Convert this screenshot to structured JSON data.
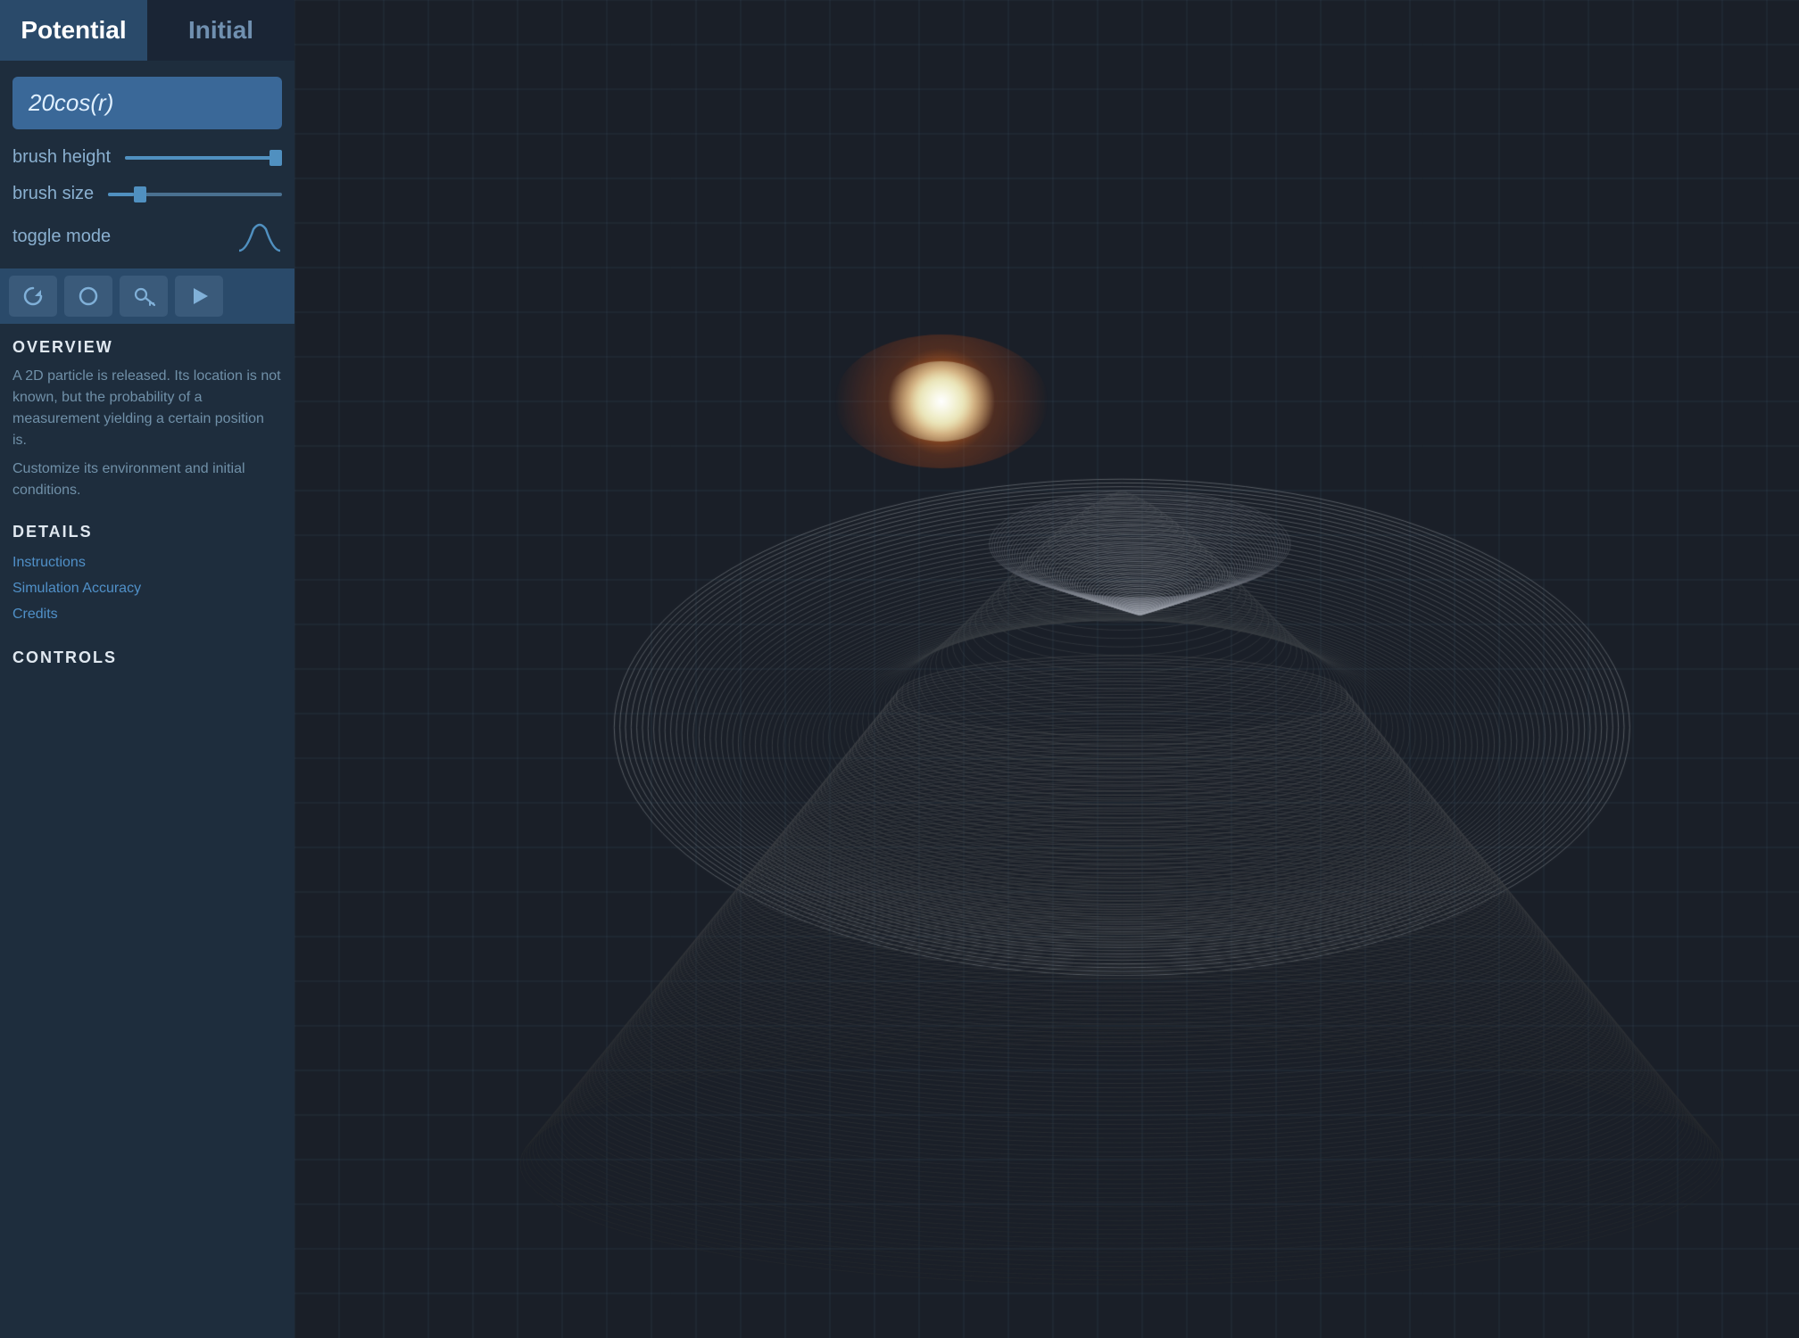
{
  "tabs": [
    {
      "id": "potential",
      "label": "Potential",
      "active": true
    },
    {
      "id": "initial",
      "label": "Initial",
      "active": false
    }
  ],
  "formula": {
    "text": "20cos(r)"
  },
  "controls": {
    "brush_height": {
      "label": "brush height",
      "value": 100,
      "min": 0,
      "max": 100
    },
    "brush_size": {
      "label": "brush size",
      "value": 15,
      "min": 0,
      "max": 100
    },
    "toggle_mode": {
      "label": "toggle mode"
    }
  },
  "toolbar": {
    "buttons": [
      {
        "id": "reset",
        "icon": "↺",
        "label": "reset"
      },
      {
        "id": "circle",
        "icon": "◯",
        "label": "circle"
      },
      {
        "id": "key",
        "icon": "🔑",
        "label": "key"
      },
      {
        "id": "play",
        "icon": "▶",
        "label": "play"
      }
    ]
  },
  "overview": {
    "title": "OVERVIEW",
    "body1": "A 2D particle is released.  Its location is not known, but the probability of a measurement yielding a certain position is.",
    "body2": "Customize its environment and initial conditions."
  },
  "details": {
    "title": "DETAILS",
    "links": [
      "Instructions",
      "Simulation Accuracy",
      "Credits"
    ]
  },
  "controls_section": {
    "title": "CONTROLS"
  },
  "colors": {
    "accent_blue": "#3a6898",
    "tab_active": "#2a4a6a",
    "tab_inactive": "#1a2535",
    "panel_bg": "#1e2d3d",
    "slider_track": "#4a7090",
    "slider_fill": "#5090c0",
    "text_label": "#8ab0d0",
    "text_link": "#5090c8",
    "section_title": "#e0e8f0",
    "body_text": "#7090a8"
  }
}
